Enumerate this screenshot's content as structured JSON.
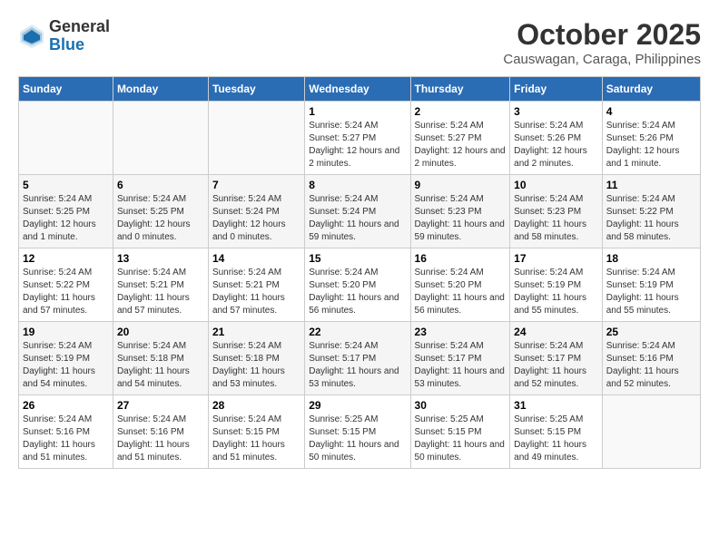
{
  "logo": {
    "general": "General",
    "blue": "Blue"
  },
  "title": "October 2025",
  "location": "Causwagan, Caraga, Philippines",
  "weekdays": [
    "Sunday",
    "Monday",
    "Tuesday",
    "Wednesday",
    "Thursday",
    "Friday",
    "Saturday"
  ],
  "weeks": [
    [
      {
        "day": "",
        "sunrise": "",
        "sunset": "",
        "daylight": ""
      },
      {
        "day": "",
        "sunrise": "",
        "sunset": "",
        "daylight": ""
      },
      {
        "day": "",
        "sunrise": "",
        "sunset": "",
        "daylight": ""
      },
      {
        "day": "1",
        "sunrise": "Sunrise: 5:24 AM",
        "sunset": "Sunset: 5:27 PM",
        "daylight": "Daylight: 12 hours and 2 minutes."
      },
      {
        "day": "2",
        "sunrise": "Sunrise: 5:24 AM",
        "sunset": "Sunset: 5:27 PM",
        "daylight": "Daylight: 12 hours and 2 minutes."
      },
      {
        "day": "3",
        "sunrise": "Sunrise: 5:24 AM",
        "sunset": "Sunset: 5:26 PM",
        "daylight": "Daylight: 12 hours and 2 minutes."
      },
      {
        "day": "4",
        "sunrise": "Sunrise: 5:24 AM",
        "sunset": "Sunset: 5:26 PM",
        "daylight": "Daylight: 12 hours and 1 minute."
      }
    ],
    [
      {
        "day": "5",
        "sunrise": "Sunrise: 5:24 AM",
        "sunset": "Sunset: 5:25 PM",
        "daylight": "Daylight: 12 hours and 1 minute."
      },
      {
        "day": "6",
        "sunrise": "Sunrise: 5:24 AM",
        "sunset": "Sunset: 5:25 PM",
        "daylight": "Daylight: 12 hours and 0 minutes."
      },
      {
        "day": "7",
        "sunrise": "Sunrise: 5:24 AM",
        "sunset": "Sunset: 5:24 PM",
        "daylight": "Daylight: 12 hours and 0 minutes."
      },
      {
        "day": "8",
        "sunrise": "Sunrise: 5:24 AM",
        "sunset": "Sunset: 5:24 PM",
        "daylight": "Daylight: 11 hours and 59 minutes."
      },
      {
        "day": "9",
        "sunrise": "Sunrise: 5:24 AM",
        "sunset": "Sunset: 5:23 PM",
        "daylight": "Daylight: 11 hours and 59 minutes."
      },
      {
        "day": "10",
        "sunrise": "Sunrise: 5:24 AM",
        "sunset": "Sunset: 5:23 PM",
        "daylight": "Daylight: 11 hours and 58 minutes."
      },
      {
        "day": "11",
        "sunrise": "Sunrise: 5:24 AM",
        "sunset": "Sunset: 5:22 PM",
        "daylight": "Daylight: 11 hours and 58 minutes."
      }
    ],
    [
      {
        "day": "12",
        "sunrise": "Sunrise: 5:24 AM",
        "sunset": "Sunset: 5:22 PM",
        "daylight": "Daylight: 11 hours and 57 minutes."
      },
      {
        "day": "13",
        "sunrise": "Sunrise: 5:24 AM",
        "sunset": "Sunset: 5:21 PM",
        "daylight": "Daylight: 11 hours and 57 minutes."
      },
      {
        "day": "14",
        "sunrise": "Sunrise: 5:24 AM",
        "sunset": "Sunset: 5:21 PM",
        "daylight": "Daylight: 11 hours and 57 minutes."
      },
      {
        "day": "15",
        "sunrise": "Sunrise: 5:24 AM",
        "sunset": "Sunset: 5:20 PM",
        "daylight": "Daylight: 11 hours and 56 minutes."
      },
      {
        "day": "16",
        "sunrise": "Sunrise: 5:24 AM",
        "sunset": "Sunset: 5:20 PM",
        "daylight": "Daylight: 11 hours and 56 minutes."
      },
      {
        "day": "17",
        "sunrise": "Sunrise: 5:24 AM",
        "sunset": "Sunset: 5:19 PM",
        "daylight": "Daylight: 11 hours and 55 minutes."
      },
      {
        "day": "18",
        "sunrise": "Sunrise: 5:24 AM",
        "sunset": "Sunset: 5:19 PM",
        "daylight": "Daylight: 11 hours and 55 minutes."
      }
    ],
    [
      {
        "day": "19",
        "sunrise": "Sunrise: 5:24 AM",
        "sunset": "Sunset: 5:19 PM",
        "daylight": "Daylight: 11 hours and 54 minutes."
      },
      {
        "day": "20",
        "sunrise": "Sunrise: 5:24 AM",
        "sunset": "Sunset: 5:18 PM",
        "daylight": "Daylight: 11 hours and 54 minutes."
      },
      {
        "day": "21",
        "sunrise": "Sunrise: 5:24 AM",
        "sunset": "Sunset: 5:18 PM",
        "daylight": "Daylight: 11 hours and 53 minutes."
      },
      {
        "day": "22",
        "sunrise": "Sunrise: 5:24 AM",
        "sunset": "Sunset: 5:17 PM",
        "daylight": "Daylight: 11 hours and 53 minutes."
      },
      {
        "day": "23",
        "sunrise": "Sunrise: 5:24 AM",
        "sunset": "Sunset: 5:17 PM",
        "daylight": "Daylight: 11 hours and 53 minutes."
      },
      {
        "day": "24",
        "sunrise": "Sunrise: 5:24 AM",
        "sunset": "Sunset: 5:17 PM",
        "daylight": "Daylight: 11 hours and 52 minutes."
      },
      {
        "day": "25",
        "sunrise": "Sunrise: 5:24 AM",
        "sunset": "Sunset: 5:16 PM",
        "daylight": "Daylight: 11 hours and 52 minutes."
      }
    ],
    [
      {
        "day": "26",
        "sunrise": "Sunrise: 5:24 AM",
        "sunset": "Sunset: 5:16 PM",
        "daylight": "Daylight: 11 hours and 51 minutes."
      },
      {
        "day": "27",
        "sunrise": "Sunrise: 5:24 AM",
        "sunset": "Sunset: 5:16 PM",
        "daylight": "Daylight: 11 hours and 51 minutes."
      },
      {
        "day": "28",
        "sunrise": "Sunrise: 5:24 AM",
        "sunset": "Sunset: 5:15 PM",
        "daylight": "Daylight: 11 hours and 51 minutes."
      },
      {
        "day": "29",
        "sunrise": "Sunrise: 5:25 AM",
        "sunset": "Sunset: 5:15 PM",
        "daylight": "Daylight: 11 hours and 50 minutes."
      },
      {
        "day": "30",
        "sunrise": "Sunrise: 5:25 AM",
        "sunset": "Sunset: 5:15 PM",
        "daylight": "Daylight: 11 hours and 50 minutes."
      },
      {
        "day": "31",
        "sunrise": "Sunrise: 5:25 AM",
        "sunset": "Sunset: 5:15 PM",
        "daylight": "Daylight: 11 hours and 49 minutes."
      },
      {
        "day": "",
        "sunrise": "",
        "sunset": "",
        "daylight": ""
      }
    ]
  ]
}
